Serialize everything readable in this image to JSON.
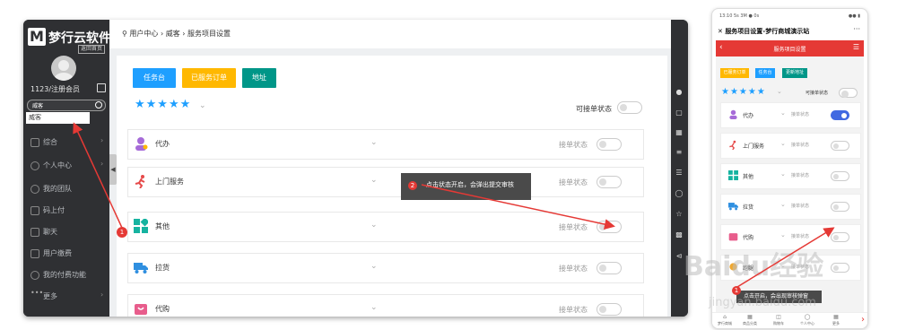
{
  "brand": {
    "logo_letter": "M",
    "name": "梦行云软件",
    "back_label": "返回首页"
  },
  "user": {
    "name": "1123/注册会员"
  },
  "sidebar_search": {
    "value": "威客",
    "result": "威客"
  },
  "sidebar": {
    "items": [
      {
        "label": "综合",
        "icon": "grid-icon"
      },
      {
        "label": "个人中心",
        "icon": "user-icon"
      },
      {
        "label": "我的团队",
        "icon": "team-icon"
      },
      {
        "label": "码上付",
        "icon": "pay-icon"
      },
      {
        "label": "聊天",
        "icon": "chat-icon"
      },
      {
        "label": "用户缴费",
        "icon": "fee-icon"
      },
      {
        "label": "我的付费功能",
        "icon": "paid-icon"
      },
      {
        "label": "更多",
        "icon": "more-icon"
      }
    ]
  },
  "breadcrumb": {
    "text": "用户中心 › 威客 › 服务项目设置"
  },
  "toolbar": {
    "btn_tasks": "任务台",
    "btn_orders": "已服务订单",
    "btn_address": "地址"
  },
  "rating": {
    "stars": "★★★★★",
    "status_label": "可接单状态"
  },
  "services": [
    {
      "name": "代办",
      "status_label": "接单状态",
      "on": false,
      "color": "#a66bd8"
    },
    {
      "name": "上门服务",
      "status_label": "接单状态",
      "on": false,
      "color": "#e64a4a"
    },
    {
      "name": "其他",
      "status_label": "接单状态",
      "on": false,
      "color": "#16b3a0"
    },
    {
      "name": "拉货",
      "status_label": "接单状态",
      "on": false,
      "color": "#2f8fe0"
    },
    {
      "name": "代购",
      "status_label": "接单状态",
      "on": false,
      "color": "#e85d8c"
    }
  ],
  "tooltip": {
    "badge": "2",
    "text": "点击状态开启，会弹出提交审核"
  },
  "annotation_1": {
    "badge": "1"
  },
  "phone": {
    "status_time": "13:10 5s 3M ● 0s",
    "status_right": "●● ▮",
    "title": "服务项目设置-梦行商城演示站",
    "more": "···",
    "header": "服务项目设置",
    "buttons": [
      "已服务订单",
      "任务台",
      "更新地址"
    ],
    "button_colors": [
      "#ffb800",
      "#1e9fff",
      "#009688"
    ],
    "stars": "★★★★★",
    "status_label": "可接单状态",
    "rows": [
      {
        "name": "代办",
        "status_label": "接单状态",
        "on": true
      },
      {
        "name": "上门服务",
        "status_label": "接单状态",
        "on": false
      },
      {
        "name": "其他",
        "status_label": "接单状态",
        "on": false
      },
      {
        "name": "拉货",
        "status_label": "接单状态",
        "on": false
      },
      {
        "name": "代购",
        "status_label": "接单状态",
        "on": false
      },
      {
        "name": "跑腿",
        "status_label": "接单状态",
        "on": false
      }
    ],
    "tip": {
      "badge": "1",
      "text": "点击开启，会出现审核弹窗"
    },
    "nav": [
      "梦行商城",
      "商品分类",
      "购物车",
      "个人中心",
      "更多"
    ]
  },
  "watermark": {
    "brand": "Baidu经验",
    "url": "jingyan.baidu.com"
  },
  "colors": {
    "accent_blue": "#1e9fff",
    "red": "#e53935",
    "dark_sidebar": "#2f3033"
  }
}
